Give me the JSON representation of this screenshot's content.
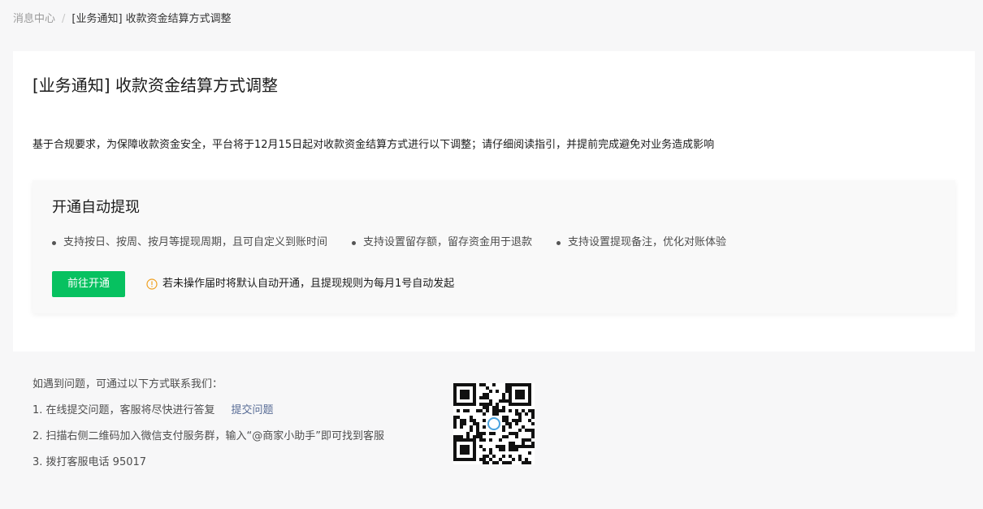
{
  "breadcrumb": {
    "root": "消息中心",
    "separator": "/",
    "current": "[业务通知] 收款资金结算方式调整"
  },
  "notice": {
    "title": "[业务通知] 收款资金结算方式调整",
    "intro": "基于合规要求，为保障收款资金安全，平台将于12月15日起对收款资金结算方式进行以下调整；请仔细阅读指引，并提前完成避免对业务造成影响"
  },
  "panel": {
    "title": "开通自动提现",
    "features": [
      "支持按日、按周、按月等提现周期，且可自定义到账时间",
      "支持设置留存额，留存资金用于退款",
      "支持设置提现备注，优化对账体验"
    ],
    "cta_label": "前往开通",
    "warning_icon": "warning-circle-icon",
    "warning_text": "若未操作届时将默认自动开通，且提现规则为每月1号自动发起"
  },
  "help": {
    "intro": "如遇到问题，可通过以下方式联系我们：",
    "line1": "1. 在线提交问题，客服将尽快进行答复",
    "line1_link": "提交问题",
    "line2": "2. 扫描右侧二维码加入微信支付服务群，输入“@商家小助手”即可找到客服",
    "line3": "3. 拨打客服电话 95017"
  },
  "colors": {
    "brand_green": "#07c160",
    "link_blue": "#576b95",
    "warning_orange": "#f0a020",
    "page_bg": "#f7f7f8"
  }
}
